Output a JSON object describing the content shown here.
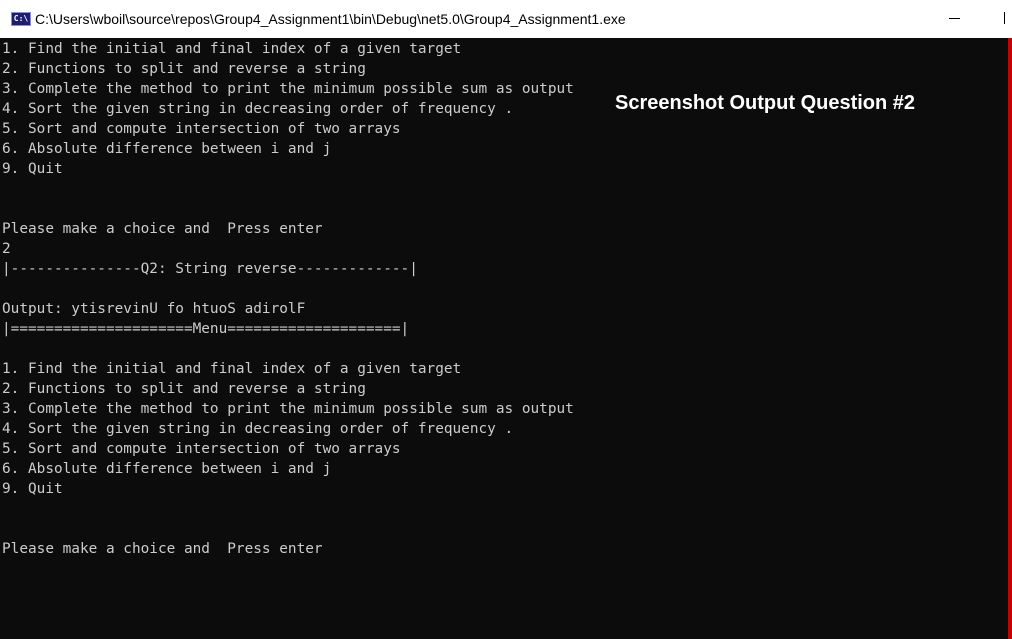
{
  "window": {
    "icon_text": "C:\\",
    "title": "C:\\Users\\wboil\\source\\repos\\Group4_Assignment1\\bin\\Debug\\net5.0\\Group4_Assignment1.exe",
    "minimize_glyph": "—"
  },
  "overlay": {
    "caption": "Screenshot Output Question #2"
  },
  "console": {
    "lines": [
      "1. Find the initial and final index of a given target",
      "2. Functions to split and reverse a string",
      "3. Complete the method to print the minimum possible sum as output",
      "4. Sort the given string in decreasing order of frequency .",
      "5. Sort and compute intersection of two arrays",
      "6. Absolute difference between i and j",
      "9. Quit",
      "",
      "",
      "Please make a choice and  Press enter",
      "2",
      "|---------------Q2: String reverse-------------|",
      "",
      "Output: ytisrevinU fo htuoS adirolF",
      "|=====================Menu====================|",
      "",
      "1. Find the initial and final index of a given target",
      "2. Functions to split and reverse a string",
      "3. Complete the method to print the minimum possible sum as output",
      "4. Sort the given string in decreasing order of frequency .",
      "5. Sort and compute intersection of two arrays",
      "6. Absolute difference between i and j",
      "9. Quit",
      "",
      "",
      "Please make a choice and  Press enter"
    ]
  },
  "colors": {
    "console_background": "#0c0c0c",
    "console_text": "#cccccc",
    "titlebar_background": "#ffffff",
    "accent_edge": "#c80000"
  }
}
